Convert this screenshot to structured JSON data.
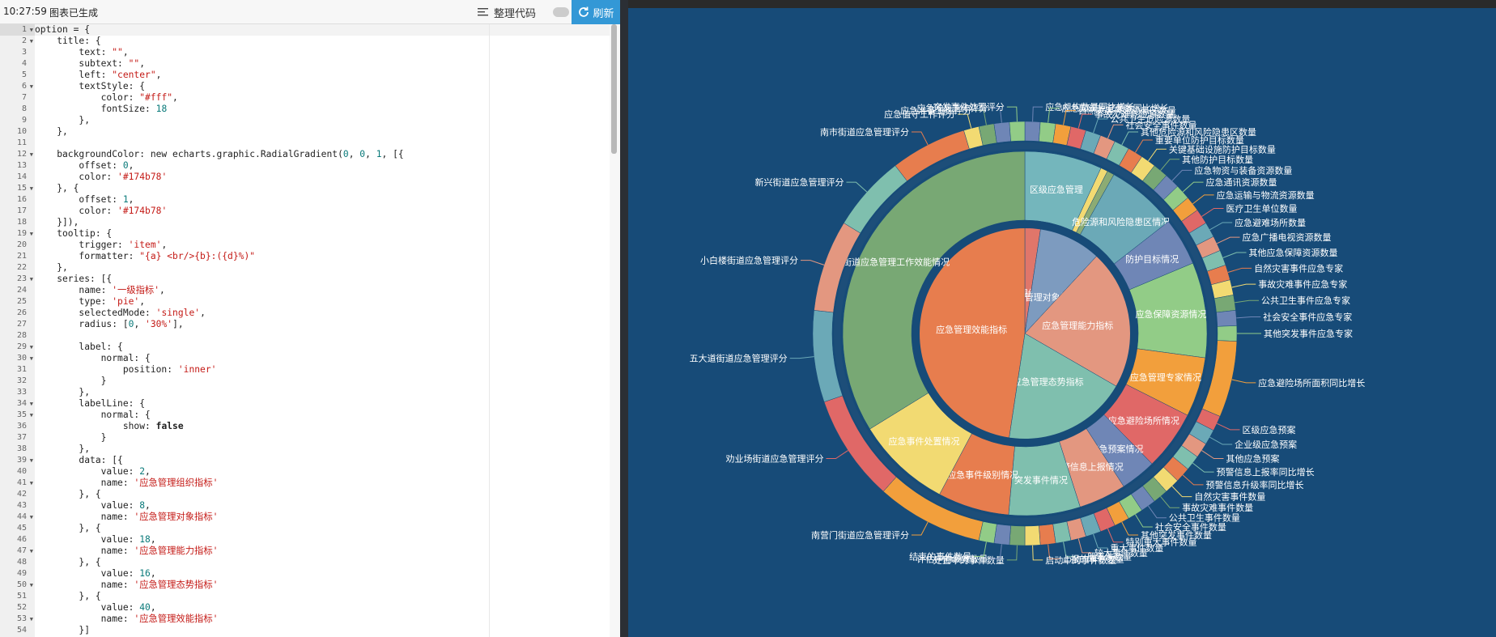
{
  "toolbar": {
    "time": "10:27:59",
    "status": "图表已生成",
    "format_label": "整理代码",
    "refresh_label": "刷新"
  },
  "editor": {
    "active_line": 1,
    "lines": [
      [
        [
          "option = {",
          ""
        ]
      ],
      [
        [
          "    title: {",
          ""
        ]
      ],
      [
        [
          "        text: ",
          ""
        ],
        [
          "\"\"",
          "s"
        ],
        [
          ",",
          ""
        ]
      ],
      [
        [
          "        subtext: ",
          ""
        ],
        [
          "\"\"",
          "s"
        ],
        [
          ",",
          ""
        ]
      ],
      [
        [
          "        left: ",
          ""
        ],
        [
          "\"center\"",
          "s"
        ],
        [
          ",",
          ""
        ]
      ],
      [
        [
          "        textStyle: {",
          ""
        ]
      ],
      [
        [
          "            color: ",
          ""
        ],
        [
          "\"#fff\"",
          "s"
        ],
        [
          ",",
          ""
        ]
      ],
      [
        [
          "            fontSize: ",
          ""
        ],
        [
          "18",
          "n"
        ]
      ],
      [
        [
          "        },",
          ""
        ]
      ],
      [
        [
          "    },",
          ""
        ]
      ],
      [
        [
          "",
          ""
        ]
      ],
      [
        [
          "    backgroundColor: new echarts.graphic.RadialGradient(",
          ""
        ],
        [
          "0",
          "n"
        ],
        [
          ", ",
          ""
        ],
        [
          "0",
          "n"
        ],
        [
          ", ",
          ""
        ],
        [
          "1",
          "n"
        ],
        [
          ", [{",
          ""
        ]
      ],
      [
        [
          "        offset: ",
          ""
        ],
        [
          "0",
          "n"
        ],
        [
          ",",
          ""
        ]
      ],
      [
        [
          "        color: ",
          ""
        ],
        [
          "'#174b78'",
          "s"
        ]
      ],
      [
        [
          "    }, {",
          ""
        ]
      ],
      [
        [
          "        offset: ",
          ""
        ],
        [
          "1",
          "n"
        ],
        [
          ",",
          ""
        ]
      ],
      [
        [
          "        color: ",
          ""
        ],
        [
          "'#174b78'",
          "s"
        ]
      ],
      [
        [
          "    }]),",
          ""
        ]
      ],
      [
        [
          "    tooltip: {",
          ""
        ]
      ],
      [
        [
          "        trigger: ",
          ""
        ],
        [
          "'item'",
          "s"
        ],
        [
          ",",
          ""
        ]
      ],
      [
        [
          "        formatter: ",
          ""
        ],
        [
          "\"{a} <br/>{b}:({d}%)\"",
          "s"
        ]
      ],
      [
        [
          "    },",
          ""
        ]
      ],
      [
        [
          "    series: [{",
          ""
        ]
      ],
      [
        [
          "        name: ",
          ""
        ],
        [
          "'一级指标'",
          "s"
        ],
        [
          ",",
          ""
        ]
      ],
      [
        [
          "        type: ",
          ""
        ],
        [
          "'pie'",
          "s"
        ],
        [
          ",",
          ""
        ]
      ],
      [
        [
          "        selectedMode: ",
          ""
        ],
        [
          "'single'",
          "s"
        ],
        [
          ",",
          ""
        ]
      ],
      [
        [
          "        radius: [",
          ""
        ],
        [
          "0",
          "n"
        ],
        [
          ", ",
          ""
        ],
        [
          "'30%'",
          "s"
        ],
        [
          "],",
          ""
        ]
      ],
      [
        [
          "",
          ""
        ]
      ],
      [
        [
          "        label: {",
          ""
        ]
      ],
      [
        [
          "            normal: {",
          ""
        ]
      ],
      [
        [
          "                position: ",
          ""
        ],
        [
          "'inner'",
          "s"
        ]
      ],
      [
        [
          "            }",
          ""
        ]
      ],
      [
        [
          "        },",
          ""
        ]
      ],
      [
        [
          "        labelLine: {",
          ""
        ]
      ],
      [
        [
          "            normal: {",
          ""
        ]
      ],
      [
        [
          "                show: ",
          ""
        ],
        [
          "false",
          "b"
        ]
      ],
      [
        [
          "            }",
          ""
        ]
      ],
      [
        [
          "        },",
          ""
        ]
      ],
      [
        [
          "        data: [{",
          ""
        ]
      ],
      [
        [
          "            value: ",
          ""
        ],
        [
          "2",
          "n"
        ],
        [
          ",",
          ""
        ]
      ],
      [
        [
          "            name: ",
          ""
        ],
        [
          "'应急管理组织指标'",
          "s"
        ]
      ],
      [
        [
          "        }, {",
          ""
        ]
      ],
      [
        [
          "            value: ",
          ""
        ],
        [
          "8",
          "n"
        ],
        [
          ",",
          ""
        ]
      ],
      [
        [
          "            name: ",
          ""
        ],
        [
          "'应急管理对象指标'",
          "s"
        ]
      ],
      [
        [
          "        }, {",
          ""
        ]
      ],
      [
        [
          "            value: ",
          ""
        ],
        [
          "18",
          "n"
        ],
        [
          ",",
          ""
        ]
      ],
      [
        [
          "            name: ",
          ""
        ],
        [
          "'应急管理能力指标'",
          "s"
        ]
      ],
      [
        [
          "        }, {",
          ""
        ]
      ],
      [
        [
          "            value: ",
          ""
        ],
        [
          "16",
          "n"
        ],
        [
          ",",
          ""
        ]
      ],
      [
        [
          "            name: ",
          ""
        ],
        [
          "'应急管理态势指标'",
          "s"
        ]
      ],
      [
        [
          "        }, {",
          ""
        ]
      ],
      [
        [
          "            value: ",
          ""
        ],
        [
          "40",
          "n"
        ],
        [
          ",",
          ""
        ]
      ],
      [
        [
          "            name: ",
          ""
        ],
        [
          "'应急管理效能指标'",
          "s"
        ]
      ],
      [
        [
          "        }]",
          ""
        ]
      ]
    ],
    "folds": [
      1,
      2,
      6,
      12,
      15,
      19,
      23,
      29,
      30,
      34,
      35,
      39,
      41,
      44,
      47,
      50,
      53
    ]
  },
  "chart_data": {
    "type": "pie",
    "background": "#174b78",
    "inner": {
      "radius": "0-30%",
      "data": [
        {
          "name": "应急管理组织指标",
          "value": 2,
          "color": "#e0766a"
        },
        {
          "name": "应急管理对象指标",
          "value": 8,
          "color": "#7d9bbf"
        },
        {
          "name": "应急管理能力指标",
          "value": 18,
          "color": "#e39780"
        },
        {
          "name": "应急管理态势指标",
          "value": 16,
          "color": "#7fbfae"
        },
        {
          "name": "应急管理效能指标",
          "value": 40,
          "color": "#e77d4e"
        }
      ]
    },
    "middle": {
      "data": [
        {
          "name": "区级应急管理",
          "value": 6.5,
          "color": "#74b6bc"
        },
        {
          "name": "",
          "value": 0.6,
          "color": "#f2da72"
        },
        {
          "name": "",
          "value": 0.6,
          "color": "#8cab74"
        },
        {
          "name": "危险源和风险隐患区情况",
          "value": 6,
          "color": "#6ba9b7"
        },
        {
          "name": "防护目标情况",
          "value": 4,
          "color": "#6f86b6"
        },
        {
          "name": "应急保障资源情况",
          "value": 8,
          "color": "#92cc87"
        },
        {
          "name": "应急管理专家情况",
          "value": 5,
          "color": "#f29f3c"
        },
        {
          "name": "应急避险场所情况",
          "value": 5,
          "color": "#e06867"
        },
        {
          "name": "应急预案情况",
          "value": 3,
          "color": "#6f86b6"
        },
        {
          "name": "预警信息上报情况",
          "value": 4,
          "color": "#e39780"
        },
        {
          "name": "突发事件情况",
          "value": 6,
          "color": "#7fbfae"
        },
        {
          "name": "应急事件级别情况",
          "value": 6,
          "color": "#e77d4e"
        },
        {
          "name": "应急事件处置情况",
          "value": 8,
          "color": "#f2da72"
        },
        {
          "name": "街道应急管理工作效能情况",
          "value": 32,
          "color": "#78a874"
        }
      ]
    },
    "outer": {
      "data": [
        {
          "name": "应急机构数量同比增长",
          "value": 1
        },
        {
          "name": "应急知识库记录数同比增长",
          "value": 1
        },
        {
          "name": "自然灾害风险隐患区数量",
          "value": 1
        },
        {
          "name": "事故灾难危险源数量",
          "value": 1
        },
        {
          "name": "公共卫生危险源数量",
          "value": 1
        },
        {
          "name": "社会安全事件数量",
          "value": 1
        },
        {
          "name": "其他危险源和风险隐患区数量",
          "value": 1
        },
        {
          "name": "重要单位防护目标数量",
          "value": 1
        },
        {
          "name": "关键基础设施防护目标数量",
          "value": 1
        },
        {
          "name": "其他防护目标数量",
          "value": 1
        },
        {
          "name": "应急物资与装备资源数量",
          "value": 1
        },
        {
          "name": "应急通讯资源数量",
          "value": 1
        },
        {
          "name": "应急运输与物流资源数量",
          "value": 1
        },
        {
          "name": "医疗卫生单位数量",
          "value": 1
        },
        {
          "name": "应急避难场所数量",
          "value": 1
        },
        {
          "name": "应急广播电视资源数量",
          "value": 1
        },
        {
          "name": "其他应急保障资源数量",
          "value": 1
        },
        {
          "name": "自然灾害事件应急专家",
          "value": 1
        },
        {
          "name": "事故灾难事件应急专家",
          "value": 1
        },
        {
          "name": "公共卫生事件应急专家",
          "value": 1
        },
        {
          "name": "社会安全事件应急专家",
          "value": 1
        },
        {
          "name": "其他突发事件应急专家",
          "value": 1
        },
        {
          "name": "应急避险场所面积同比增长",
          "value": 5
        },
        {
          "name": "区级应急预案",
          "value": 1
        },
        {
          "name": "企业级应急预案",
          "value": 1
        },
        {
          "name": "其他应急预案",
          "value": 1
        },
        {
          "name": "预警信息上报率同比增长",
          "value": 1
        },
        {
          "name": "预警信息升级率同比增长",
          "value": 1
        },
        {
          "name": "自然灾害事件数量",
          "value": 1
        },
        {
          "name": "事故灾难事件数量",
          "value": 1
        },
        {
          "name": "公共卫生事件数量",
          "value": 1
        },
        {
          "name": "社会安全事件数量",
          "value": 1
        },
        {
          "name": "其他突发事件数量",
          "value": 1
        },
        {
          "name": "特别重大事件数量",
          "value": 1
        },
        {
          "name": "重大事件数量",
          "value": 1
        },
        {
          "name": "较大事件数量",
          "value": 1
        },
        {
          "name": "一般事件数量",
          "value": 1
        },
        {
          "name": "上报的事件数量",
          "value": 1
        },
        {
          "name": "启动中的事件数量",
          "value": 1
        },
        {
          "name": "处置中的事件数量",
          "value": 1
        },
        {
          "name": "评估中的绩效数量",
          "value": 1
        },
        {
          "name": "结束的事件数量",
          "value": 1
        },
        {
          "name": "南营门街道应急管理评分",
          "value": 7
        },
        {
          "name": "劝业场街道应急管理评分",
          "value": 7
        },
        {
          "name": "五大道街道应急管理评分",
          "value": 6
        },
        {
          "name": "小白楼街道应急管理评分",
          "value": 6
        },
        {
          "name": "新兴街道应急管理评分",
          "value": 5
        },
        {
          "name": "南市街道应急管理评分",
          "value": 5
        },
        {
          "name": "应急值守工作评分",
          "value": 1
        },
        {
          "name": "应急准备工作评分",
          "value": 1
        },
        {
          "name": "应急响应工作评分",
          "value": 1
        },
        {
          "name": "突发事件处置评分",
          "value": 1
        }
      ]
    },
    "inner_label_overlap": "应急管理组织指标"
  }
}
